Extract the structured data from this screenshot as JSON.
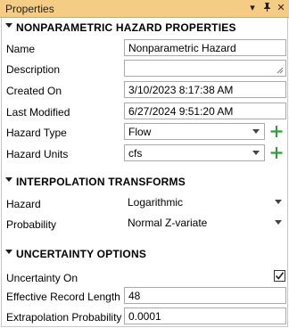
{
  "window": {
    "title": "Properties"
  },
  "titlebar_icons": [
    "dropdown-icon",
    "pin-icon",
    "close-icon"
  ],
  "sections": {
    "nonparametric": "NONPARAMETRIC HAZARD PROPERTIES",
    "interpolation": "INTERPOLATION TRANSFORMS",
    "uncertainty": "UNCERTAINTY OPTIONS"
  },
  "fields": {
    "name": {
      "label": "Name",
      "value": "Nonparametric Hazard"
    },
    "description": {
      "label": "Description",
      "value": ""
    },
    "created_on": {
      "label": "Created On",
      "value": "3/10/2023 8:17:38 AM"
    },
    "last_modified": {
      "label": "Last Modified",
      "value": "6/27/2024 9:51:20 AM"
    },
    "hazard_type": {
      "label": "Hazard Type",
      "value": "Flow"
    },
    "hazard_units": {
      "label": "Hazard Units",
      "value": "cfs"
    },
    "hazard_transform": {
      "label": "Hazard",
      "value": "Logarithmic"
    },
    "probability_transform": {
      "label": "Probability",
      "value": "Normal Z-variate"
    },
    "uncertainty_on": {
      "label": "Uncertainty On",
      "checked": true
    },
    "effective_record_length": {
      "label": "Effective Record Length",
      "value": "48"
    },
    "extrapolation_probability": {
      "label": "Extrapolation Probability",
      "value": "0.0001"
    }
  },
  "colors": {
    "titlebar": "#f5cc84",
    "plus": "#2e9d3a"
  }
}
